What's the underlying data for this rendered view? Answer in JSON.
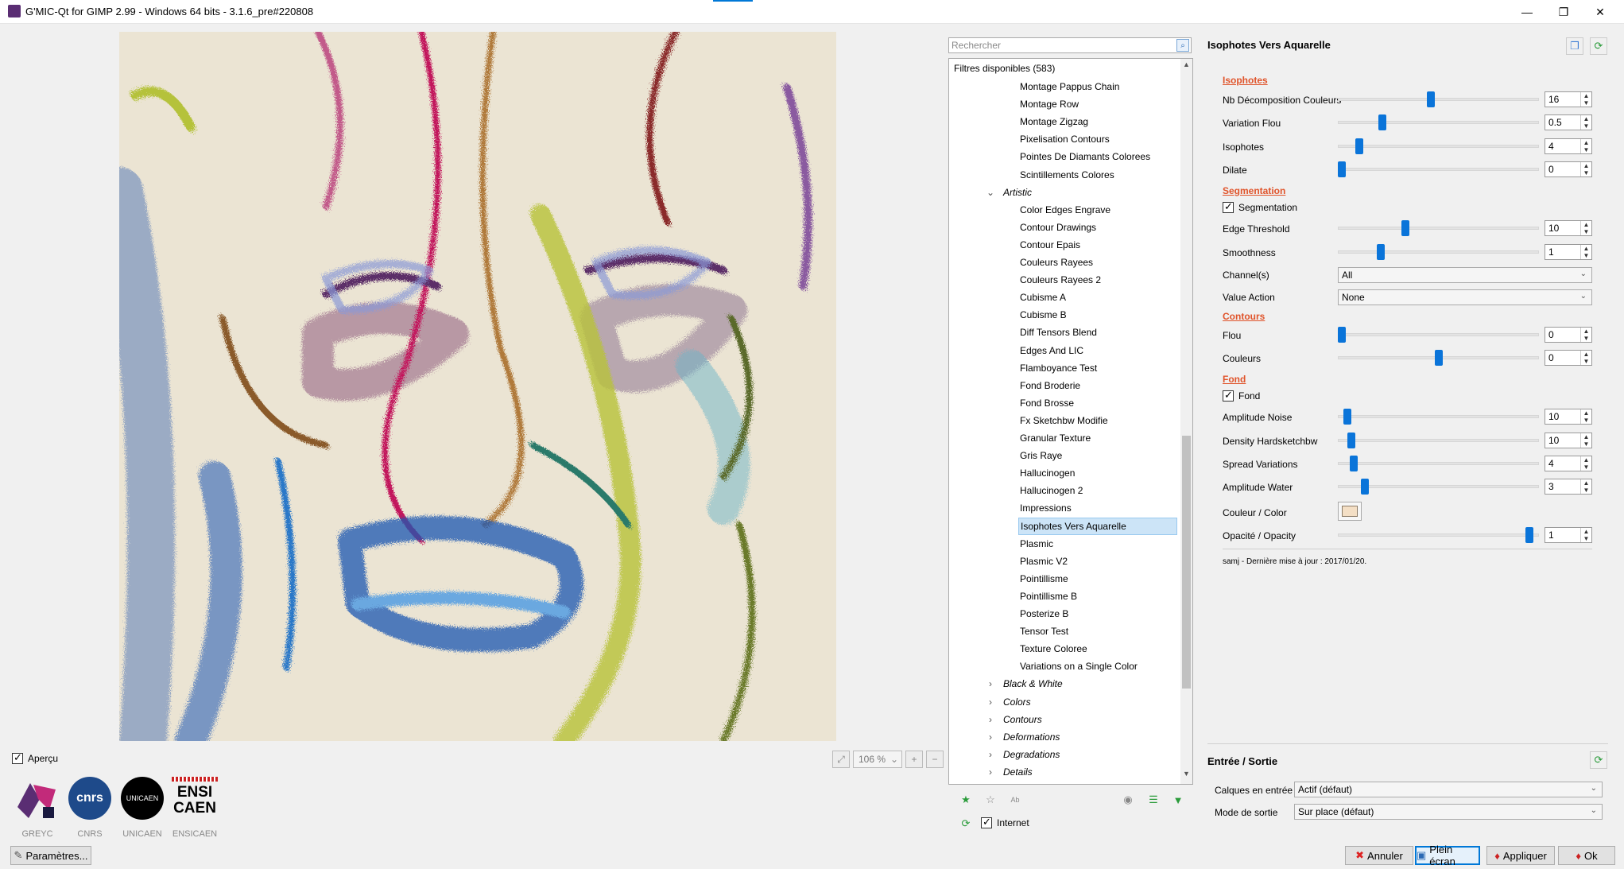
{
  "window": {
    "title": "G'MIC-Qt for GIMP 2.99 - Windows 64 bits - 3.1.6_pre#220808",
    "minimize": "—",
    "maximize": "❐",
    "close": "✕"
  },
  "preview": {
    "checkbox_label": "Aperçu",
    "zoom_value": "106 %"
  },
  "logos": [
    {
      "caption": "GREYC"
    },
    {
      "caption": "CNRS",
      "mark": "cnrs"
    },
    {
      "caption": "UNICAEN",
      "mark": "UNICAEN"
    },
    {
      "caption": "ENSICAEN",
      "mark_line1": "ENSI",
      "mark_line2": "CAEN"
    }
  ],
  "settings_button": "Paramètres...",
  "filters": {
    "search_placeholder": "Rechercher",
    "header": "Filtres disponibles (583)",
    "items_top": [
      "Montage Pappus Chain",
      "Montage Row",
      "Montage Zigzag",
      "Pixelisation Contours",
      "Pointes De Diamants Colorees",
      "Scintillements Colores"
    ],
    "group_open": "Artistic",
    "artistic_items": [
      "Color Edges Engrave",
      "Contour Drawings",
      "Contour Epais",
      "Couleurs Rayees",
      "Couleurs Rayees 2",
      "Cubisme A",
      "Cubisme B",
      "Diff Tensors Blend",
      "Edges And LIC",
      "Flamboyance Test",
      "Fond Broderie",
      "Fond Brosse",
      "Fx Sketchbw Modifie",
      "Granular Texture",
      "Gris Raye",
      "Hallucinogen",
      "Hallucinogen 2",
      "Impressions",
      "Isophotes Vers Aquarelle",
      "Plasmic",
      "Plasmic V2",
      "Pointillisme",
      "Pointillisme B",
      "Posterize B",
      "Tensor Test",
      "Texture Coloree",
      "Variations on a Single Color"
    ],
    "selected": "Isophotes Vers Aquarelle",
    "groups_closed": [
      "Black & White",
      "Colors",
      "Contours",
      "Deformations",
      "Degradations",
      "Details"
    ],
    "internet_label": "Internet"
  },
  "filter": {
    "title": "Isophotes Vers Aquarelle",
    "sections": {
      "isophotes": "Isophotes",
      "segmentation": "Segmentation",
      "contours": "Contours",
      "fond": "Fond"
    },
    "params": {
      "nb_decomp": {
        "label": "Nb Décomposition Couleurs",
        "value": "16",
        "level": 0.46
      },
      "variation_flou": {
        "label": "Variation Flou",
        "value": "0.5",
        "level": 0.21
      },
      "isophotes": {
        "label": "Isophotes",
        "value": "4",
        "level": 0.09
      },
      "dilate": {
        "label": "Dilate",
        "value": "0",
        "level": 0.0
      },
      "segmentation_check": {
        "label": "Segmentation",
        "checked": true
      },
      "edge_threshold": {
        "label": "Edge Threshold",
        "value": "10",
        "level": 0.33
      },
      "smoothness": {
        "label": "Smoothness",
        "value": "1",
        "level": 0.2
      },
      "channels": {
        "label": "Channel(s)",
        "value": "All"
      },
      "value_action": {
        "label": "Value Action",
        "value": "None"
      },
      "flou": {
        "label": "Flou",
        "value": "0",
        "level": 0.0
      },
      "couleurs": {
        "label": "Couleurs",
        "value": "0",
        "level": 0.5
      },
      "fond_check": {
        "label": "Fond",
        "checked": true
      },
      "amplitude_noise": {
        "label": "Amplitude Noise",
        "value": "10",
        "level": 0.03
      },
      "density_hardsketchbw": {
        "label": "Density Hardsketchbw",
        "value": "10",
        "level": 0.05
      },
      "spread_variations": {
        "label": "Spread Variations",
        "value": "4",
        "level": 0.06
      },
      "amplitude_water": {
        "label": "Amplitude Water",
        "value": "3",
        "level": 0.12
      },
      "couleur_color": {
        "label": "Couleur / Color",
        "color": "#f4dfc5"
      },
      "opacite": {
        "label": "Opacité / Opacity",
        "value": "1",
        "level": 0.97
      }
    },
    "author_note": "samj - Dernière mise à jour : 2017/01/20."
  },
  "io": {
    "title": "Entrée / Sortie",
    "input_label": "Calques en entrée",
    "input_value": "Actif (défaut)",
    "output_label": "Mode de sortie",
    "output_value": "Sur place (défaut)"
  },
  "buttons": {
    "cancel": "Annuler",
    "fullscreen": "Plein écran",
    "apply": "Appliquer",
    "ok": "Ok"
  }
}
